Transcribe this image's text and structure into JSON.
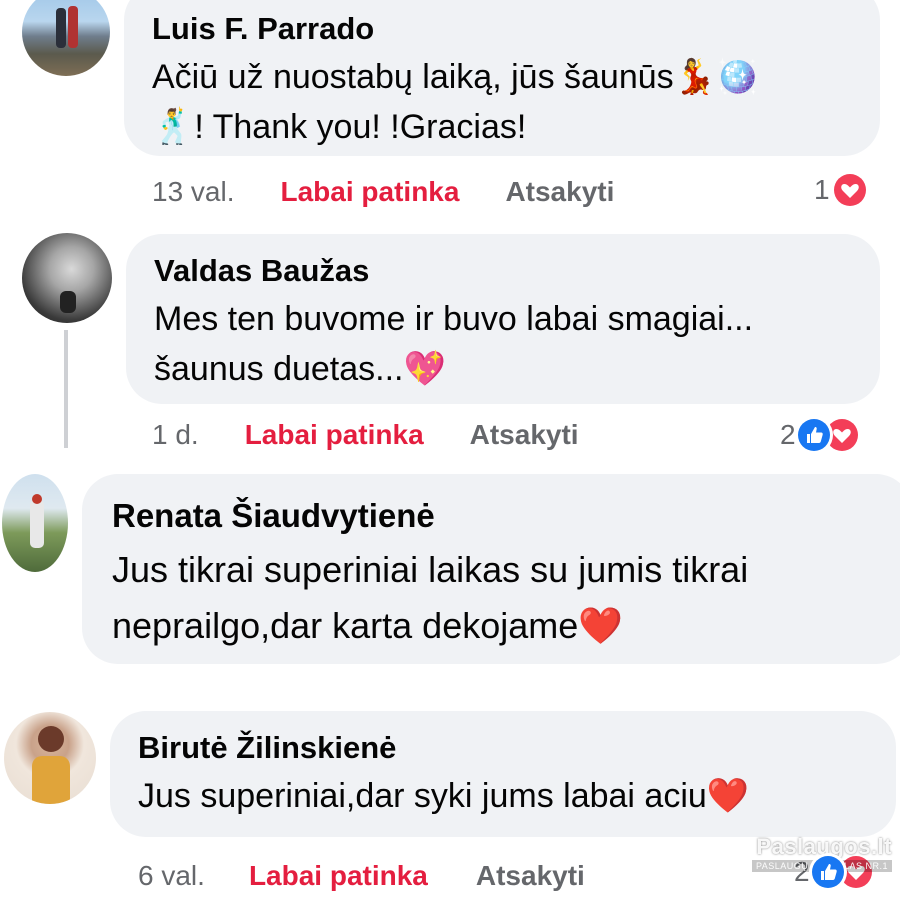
{
  "comments": [
    {
      "author": "Luis F. Parrado",
      "text_line1": "Ačiū už nuostabų laiką, jūs šaunūs💃🪩",
      "text_line2": "🕺! Thank you! !Gracias!",
      "time": "13 val.",
      "like_label": "Labai patinka",
      "reply_label": "Atsakyti",
      "reaction_count": "1",
      "reactions": [
        "love"
      ]
    },
    {
      "author": "Valdas Baužas",
      "text_line1": "Mes ten buvome ir buvo labai smagiai...",
      "text_line2": "šaunus duetas...💖",
      "time": "1 d.",
      "like_label": "Labai patinka",
      "reply_label": "Atsakyti",
      "reaction_count": "2",
      "reactions": [
        "like",
        "love"
      ]
    },
    {
      "author": "Renata Šiaudvytienė",
      "text_line1": "Jus tikrai superiniai laikas su jumis tikrai",
      "text_line2": "neprailgo,dar karta dekojame❤️"
    },
    {
      "author": "Birutė Žilinskienė",
      "text_line1": "Jus superiniai,dar syki jums labai aciu❤️",
      "time": "6 val.",
      "like_label": "Labai patinka",
      "reply_label": "Atsakyti",
      "reaction_count": "2",
      "reactions": [
        "like",
        "love"
      ]
    }
  ],
  "watermark": {
    "logo": "Paslaugos.lt",
    "sub": "PASLAUGŲ PORTALAS NR.1"
  },
  "colors": {
    "bubble": "#f0f2f5",
    "like_text": "#e41e3f",
    "meta_text": "#65676b",
    "like_icon": "#1877f2",
    "love_icon": "#f33e58"
  },
  "icons": [
    "like-icon",
    "love-icon"
  ]
}
